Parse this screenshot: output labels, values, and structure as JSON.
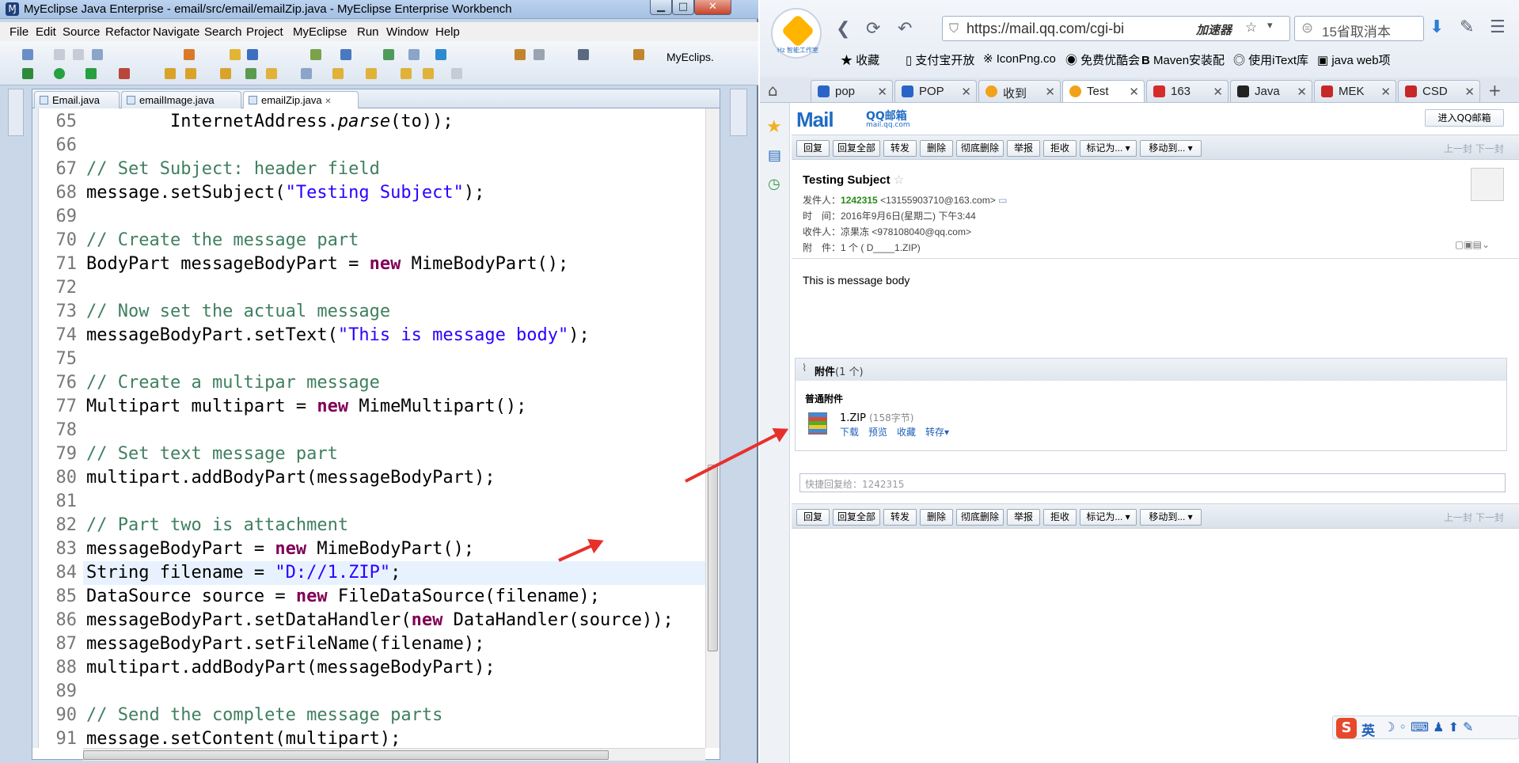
{
  "ide": {
    "title": "MyEclipse Java Enterprise - email/src/email/emailZip.java - MyEclipse Enterprise Workbench",
    "menu": [
      "File",
      "Edit",
      "Source",
      "Refactor",
      "Navigate",
      "Search",
      "Project",
      "MyEclipse",
      "Run",
      "Window",
      "Help"
    ],
    "perspective": "MyEclips.",
    "tabs": [
      {
        "label": "Email.java"
      },
      {
        "label": "emailImage.java"
      },
      {
        "label": "emailZip.java",
        "close": "✕"
      }
    ],
    "lines": [
      {
        "n": "65",
        "text": "        InternetAddress.parse(to));"
      },
      {
        "n": "66",
        "text": ""
      },
      {
        "n": "67",
        "text": "// Set Subject: header field"
      },
      {
        "n": "68",
        "pre": "message.setSubject(",
        "str": "\"Testing Subject\"",
        "post": ");"
      },
      {
        "n": "69",
        "text": ""
      },
      {
        "n": "70",
        "text": "// Create the message part"
      },
      {
        "n": "71",
        "pre": "BodyPart messageBodyPart = ",
        "kw": "new",
        "post": " MimeBodyPart();"
      },
      {
        "n": "72",
        "text": ""
      },
      {
        "n": "73",
        "text": "// Now set the actual message"
      },
      {
        "n": "74",
        "pre": "messageBodyPart.setText(",
        "str": "\"This is message body\"",
        "post": ");"
      },
      {
        "n": "75",
        "text": ""
      },
      {
        "n": "76",
        "text": "// Create a multipar message"
      },
      {
        "n": "77",
        "pre": "Multipart multipart = ",
        "kw": "new",
        "post": " MimeMultipart();"
      },
      {
        "n": "78",
        "text": ""
      },
      {
        "n": "79",
        "text": "// Set text message part"
      },
      {
        "n": "80",
        "text": "multipart.addBodyPart(messageBodyPart);"
      },
      {
        "n": "81",
        "text": ""
      },
      {
        "n": "82",
        "text": "// Part two is attachment"
      },
      {
        "n": "83",
        "pre": "messageBodyPart = ",
        "kw": "new",
        "post": " MimeBodyPart();"
      },
      {
        "n": "84",
        "pre": "String filename = ",
        "str": "\"D://1.ZIP\"",
        "post": ";"
      },
      {
        "n": "85",
        "pre": "DataSource source = ",
        "kw": "new",
        "post": " FileDataSource(filename);"
      },
      {
        "n": "86",
        "pre": "messageBodyPart.setDataHandler(",
        "kw": "new",
        "post": " DataHandler(source));"
      },
      {
        "n": "87",
        "text": "messageBodyPart.setFileName(filename);"
      },
      {
        "n": "88",
        "text": "multipart.addBodyPart(messageBodyPart);"
      },
      {
        "n": "89",
        "text": ""
      },
      {
        "n": "90",
        "text": "// Send the complete message parts"
      },
      {
        "n": "91",
        "text": "message.setContent(multipart);"
      }
    ]
  },
  "browser": {
    "url": "https://mail.qq.com/cgi-bi",
    "accelerator": "加速器",
    "search_placeholder": "15省取消本",
    "bookmarks": [
      "收藏",
      "支付宝开放",
      "IconPng.co",
      "免费优酷会",
      "Maven安装配",
      "使用iText库",
      "java web项"
    ],
    "tabs": [
      {
        "label": "pop"
      },
      {
        "label": "POP"
      },
      {
        "label": "收到"
      },
      {
        "label": "Test"
      },
      {
        "label": "163"
      },
      {
        "label": "Java"
      },
      {
        "label": "MEK"
      },
      {
        "label": "CSD"
      }
    ],
    "tab_close": "✕",
    "logo_label": "Hz 智能工作室",
    "colors": {
      "accent": "#1f6cc4",
      "sender_green": "#2a8a18",
      "arrow": "#e8302a"
    }
  },
  "mail": {
    "logo": "Mail",
    "logo_o": "o",
    "logo_sub": "QQ邮箱",
    "logo_domain": "mail.qq.com",
    "enter_button": "进入QQ邮箱",
    "actions": [
      "回复",
      "回复全部",
      "转发",
      "删除",
      "彻底删除",
      "举报",
      "拒收",
      "标记为... ▾",
      "移动到... ▾"
    ],
    "nav": "上一封 下一封",
    "subject": "Testing Subject",
    "sender_label": "发件人：",
    "sender_name": "1242315",
    "sender_addr": "<13155903710@163.com>",
    "time_label": "时　间：",
    "time_value": "2016年9月6日(星期二) 下午3:44",
    "to_label": "收件人：",
    "to_value": "凉果冻 <978108040@qq.com>",
    "attach_label": "附　件：",
    "attach_value": "1 个 ( D____1.ZIP)",
    "body": "This is message body",
    "att_header": "附件",
    "att_count": "(1 个)",
    "att_type": "普通附件",
    "att_file": "1.ZIP",
    "att_size": "(158字节)",
    "att_actions": "下载　预览　收藏　转存▾",
    "reply_placeholder": "快捷回复给：1242315"
  },
  "ime": {
    "logo": "S",
    "mode": "英"
  }
}
